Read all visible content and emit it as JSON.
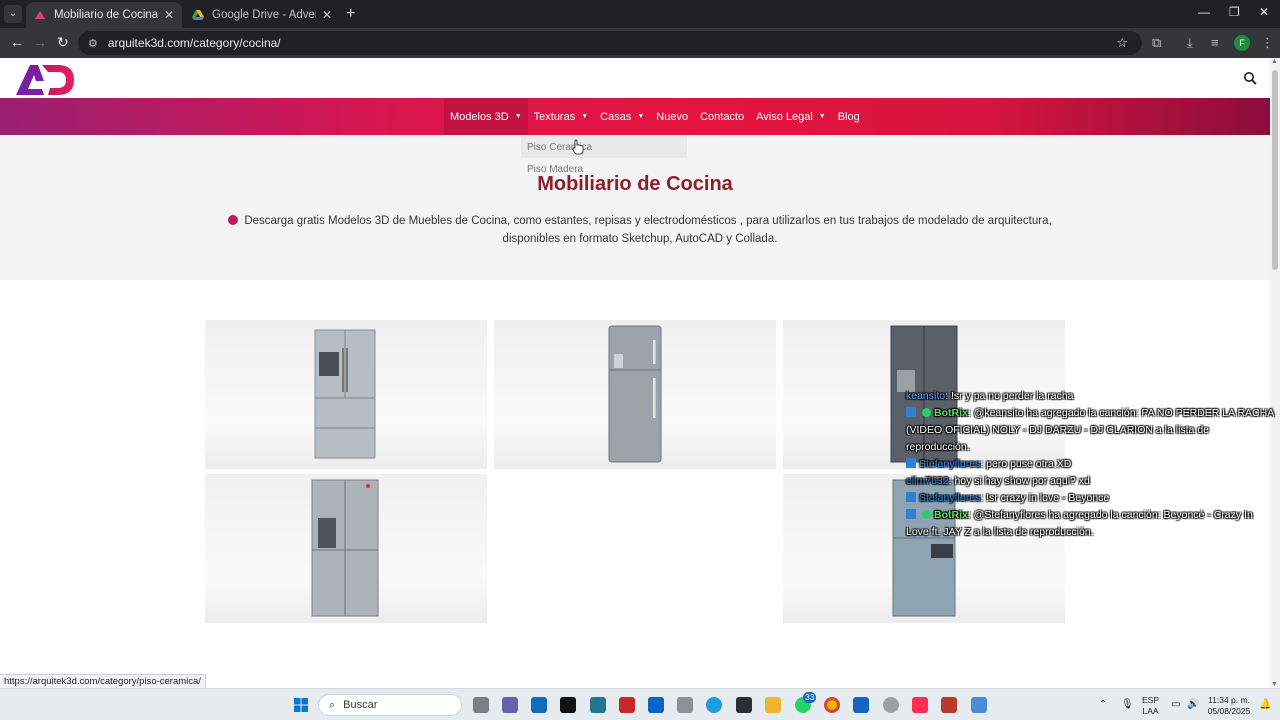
{
  "browser": {
    "tabs": [
      {
        "title": "Mobiliario de Cocina archivos -",
        "active": true
      },
      {
        "title": "Google Drive - Advertencia de",
        "active": false
      }
    ],
    "url": "arquitek3d.com/category/cocina/",
    "profile_initial": "F"
  },
  "site": {
    "nav": [
      {
        "label": "Modelos 3D",
        "has_caret": true
      },
      {
        "label": "Texturas",
        "has_caret": true
      },
      {
        "label": "Casas",
        "has_caret": true
      },
      {
        "label": "Nuevo",
        "has_caret": false
      },
      {
        "label": "Contacto",
        "has_caret": false
      },
      {
        "label": "Aviso Legal",
        "has_caret": true
      },
      {
        "label": "Blog",
        "has_caret": false
      }
    ],
    "dropdown": [
      "Piso Ceramica",
      "Piso Madera"
    ],
    "hero_title": "Mobiliario de Cocina",
    "hero_desc": "Descarga gratis Modelos 3D de Muebles de Cocina, como estantes, repisas y electrodomésticos , para utilizarlos en tus trabajos de modelado de arquitectura, disponibles en formato Sketchup, AutoCAD y Collada.",
    "accent": "#c2185b",
    "title_color": "#8c1e2e"
  },
  "status_url": "https://arquitek3d.com/category/piso-ceramica/",
  "chat": [
    {
      "user": "keansito",
      "msg": ": !sr y pa no perder la racha"
    },
    {
      "user": "BotRix",
      "msg": ": @keansito ha agregado la canción: PA NO PERDER LA RACHA (VIDEO OFICIAL) NOLY - DJ DARZU - DJ CLARION a la lista de reproducción."
    },
    {
      "user": "Stefanyflores",
      "msg": ": pero puse otra XD"
    },
    {
      "user": "elim7632",
      "msg": ": hoy si hay show por aqui? xd"
    },
    {
      "user": "Stefanyflores",
      "msg": ": !sr crazy in love - Beyonce"
    },
    {
      "user": "BotRix",
      "msg": ": @Stefanyflores ha agregado la canción: Beyoncé - Crazy In Love ft. JAY Z a la lista de reproducción."
    }
  ],
  "taskbar": {
    "search_label": "Buscar",
    "lang": "ESP",
    "lang_sub": "LAA",
    "time": "11:34 p. m.",
    "date": "05/08/2025",
    "whatsapp_badge": "33"
  }
}
